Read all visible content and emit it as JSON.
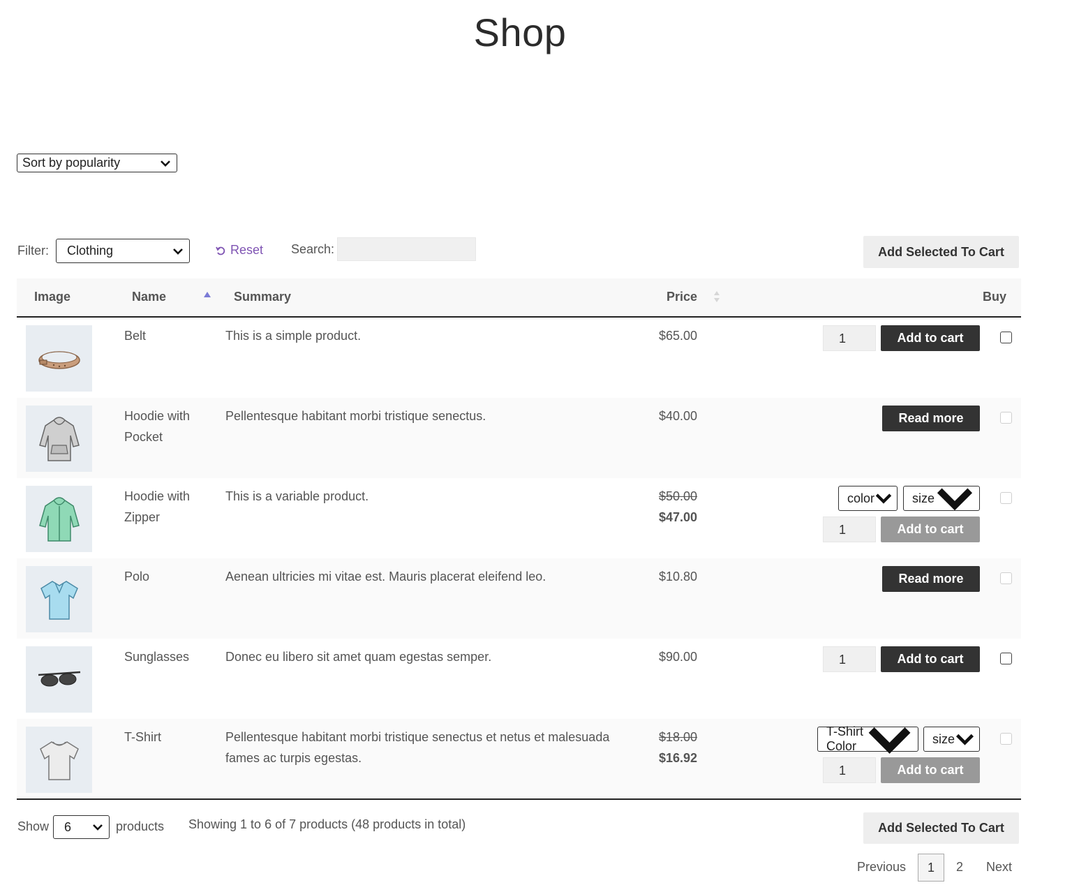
{
  "page": {
    "title": "Shop"
  },
  "sort": {
    "selected": "Sort by popularity"
  },
  "filter": {
    "label": "Filter:",
    "selected": "Clothing",
    "reset_label": "Reset",
    "search_label": "Search:",
    "search_value": ""
  },
  "actions": {
    "add_selected_label": "Add Selected To Cart"
  },
  "table": {
    "columns": {
      "image": "Image",
      "name": "Name",
      "summary": "Summary",
      "price": "Price",
      "buy": "Buy"
    },
    "rows": [
      {
        "name": "Belt",
        "summary": "This is a simple product.",
        "price": "$65.00",
        "qty": "1",
        "button": "Add to cart",
        "icon": "belt-image"
      },
      {
        "name": "Hoodie with Pocket",
        "summary": "Pellentesque habitant morbi tristique senectus.",
        "price": "$40.00",
        "button": "Read more",
        "icon": "hoodie-pocket-image"
      },
      {
        "name": "Hoodie with Zipper",
        "summary": "This is a variable product.",
        "old_price": "$50.00",
        "price": "$47.00",
        "select1": "color",
        "select2": "size",
        "qty": "1",
        "button": "Add to cart",
        "icon": "hoodie-zipper-image"
      },
      {
        "name": "Polo",
        "summary": "Aenean ultricies mi vitae est. Mauris placerat eleifend leo.",
        "price": "$10.80",
        "button": "Read more",
        "icon": "polo-image"
      },
      {
        "name": "Sunglasses",
        "summary": "Donec eu libero sit amet quam egestas semper.",
        "price": "$90.00",
        "qty": "1",
        "button": "Add to cart",
        "icon": "sunglasses-image"
      },
      {
        "name": "T-Shirt",
        "summary": "Pellentesque habitant morbi tristique senectus et netus et malesuada fames ac turpis egestas.",
        "old_price": "$18.00",
        "price": "$16.92",
        "select1": "T-Shirt Color",
        "select2": "size",
        "qty": "1",
        "button": "Add to cart",
        "icon": "tshirt-image"
      }
    ]
  },
  "footer": {
    "show_label": "Show",
    "show_selected": "6",
    "products_label": "products",
    "info": "Showing 1 to 6 of 7 products (48 products in total)",
    "pagination": {
      "previous": "Previous",
      "current": "1",
      "next_page": "2",
      "next": "Next"
    }
  },
  "colors": {
    "accent": "#7f54b3",
    "dark_button": "#333333",
    "disabled_button": "#999999",
    "header_bg": "#f8f8f8"
  }
}
